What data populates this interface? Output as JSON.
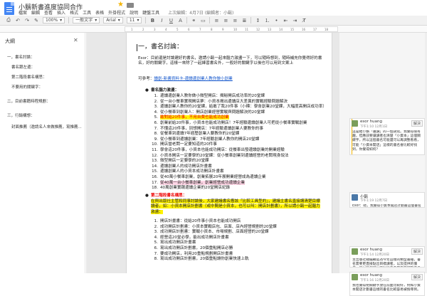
{
  "header": {
    "title": "小鬍新書進度協同合作",
    "last_edit": "上次編輯：4月7日 (編輯者：小鬍)",
    "menu": [
      "檔案",
      "編輯",
      "查看",
      "插入",
      "格式",
      "工具",
      "表格",
      "外掛程式",
      "說明",
      "鍵盤工具"
    ]
  },
  "toolbar": {
    "zoom": "100%",
    "style": "一般文字",
    "font": "Arial",
    "size": "11"
  },
  "ruler": {
    "numbers": [
      "1",
      "2",
      "3",
      "4",
      "5",
      "6",
      "7",
      "8",
      "9",
      "10",
      "11",
      "12",
      "13",
      "14",
      "15",
      "16",
      "17",
      "18"
    ]
  },
  "outline": {
    "title": "大綱",
    "items": [
      "一，書名討論：",
      "書名跟左邊：",
      "第二階段書名構思：",
      "不要用的關鍵字：",
      "二，目前書籍時程規劃：",
      "三，行銷構想：",
      "封面推薦（邀請名人來做推薦，寫推薦..."
    ]
  },
  "document": {
    "heading": "一，書名討論：",
    "intro": "Esor：目前還是討論建好的書名，邀請小鬍一起來腦力激盪一下，可以隨時想到，隨時補充你覺得好的書名，好的關鍵字，這樣一來除了一起練習書名外，一般好的關鍵字以後也可以用到文案上",
    "ref_label": "可參考：",
    "ref_link": "讀創-新書資料卡-邊讀邊創業人教你做小創業",
    "section1_title": "書名腦力激盪：",
    "list1": [
      "邊讀邊創業人教你做小微型開店：揭秘開店成功率的20堂課",
      "從一台小餐車實現開店夢：小資本揭出邊讀店大差異的實戰經驗問題解決",
      "邊讀創業人教你的20堂課，給敢了我20件事（小標：學會創業20堂課，大幅度高開店成功率）",
      "從小餐車到創業人：開店創業經營實戰與問題解決的20堂課",
      "敢對給20件事，不用自費也能成功創業",
      "創業前給20件事，小資本也能成功開店！7年經驗邊讀創業人可把從小餐車實戰創業",
      "不懂這20件事，別想開店：7年經驗邊讀創業人要教你的事",
      "從餐車到邊讀7年經歷創業人要教你的20堂課",
      "從小餐車到邊讀創業：7年經驗創業人教你的開店20堂課",
      "開店當老闆一定要知道的20件事",
      "學會這20件事，小資本也能成功開店：從餐車出發邊讀創業的開業經驗",
      "小資本開店一定要學的20堂課：從小餐車創業到邊讀經營的老闆現身說法",
      "微型開店一定要學的20堂課",
      "邊讀創業人的成功開店計畫書",
      "邊讀創業人的小資本成功開店計畫書",
      "從40萬小餐車創業，創業拓展20年展開業經營成為邊讀企業",
      "從40萬一台小餐車創業，創業經營成功邊讀企業",
      "40萬創業實踐邊讀企業的20堂開店紀錄"
    ],
    "section2_title": "第二階段書名構思：",
    "section2_note": "在與出版社主管和同事討論後，大家建議書名應該「比較工具型的」，建議主書名直接講清楚目標讀者，如：小資本開店計劃書（或中間是小資本，也可以叫：開店計劃書），所以請小鬍一起腦力激盪：",
    "list2": [
      "開店計畫書：從給20件事小資本也能成功開店",
      "成功開店計劃書：小資本實戰店包、店面、店內經營規劃的20堂課",
      "成功開店計劃書：實戰小資本、市場規劃、店面經營的20堂課",
      "經營這20堂必學，能出成功開店計畫書",
      "寫出成功開店計畫書",
      "寫出成功開店計劃書，20個重點開店必勝",
      "要成功開店，利用20重點規劃開店計畫書",
      "寫出成功開店計劃書，20個重點讓你創業快速上軌"
    ]
  },
  "comments": [
    {
      "author": "esor huang",
      "time": "下午1:10 12月1日",
      "resolve": "解決",
      "body": "這是給小鬍「邊讀」的一個試寫。我覺得很有趣，但應該要讓讀者也清楚「小資本」這個關鍵字，所以這個書名可能還可以再調整看看，可能「小資本開店」這樣的書名會比較好找到，你覺得如何？"
    },
    {
      "author": "小鬍",
      "time": "下午1:19 12月7日",
      "resolve": "",
      "body": "Esor：嗯，我覺得小資本開店計劃書這個書名挺好的。"
    },
    {
      "author": "esor huang",
      "time": "下午1:14 12月20日",
      "resolve": "解決",
      "body": "主出版社總編輯認為今年這樣的類型書籍，書名需要更直接點出目標讀者，以及提供的價值，所以我們可以再討論看看是否要調整書名方向，歡迎一起腦力激盪。"
    },
    {
      "author": "esor huang",
      "time": "下午1:16 12月20日",
      "resolve": "解決",
      "body": "我也覺得把關鍵字放在前面比較好，例如小資本開店計劃書這樣的書名比較容易被搜尋到。"
    }
  ]
}
